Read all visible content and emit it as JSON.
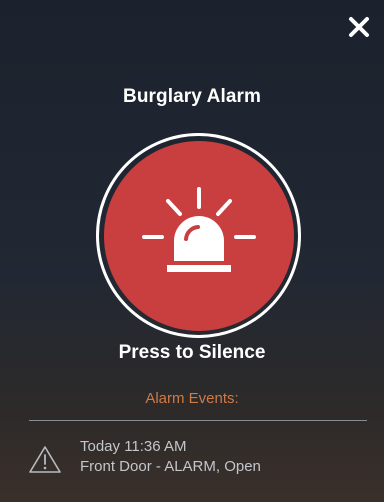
{
  "header": {
    "close_icon": "close-icon"
  },
  "alarm": {
    "title": "Burglary Alarm",
    "silence_icon": "siren-icon",
    "silence_label": "Press to Silence",
    "button_color": "#c93e3e"
  },
  "events": {
    "heading": "Alarm Events:",
    "heading_color": "#d07a45",
    "items": [
      {
        "icon": "warning-icon",
        "time": "Today 11:36 AM",
        "description": "Front Door - ALARM, Open"
      }
    ]
  }
}
